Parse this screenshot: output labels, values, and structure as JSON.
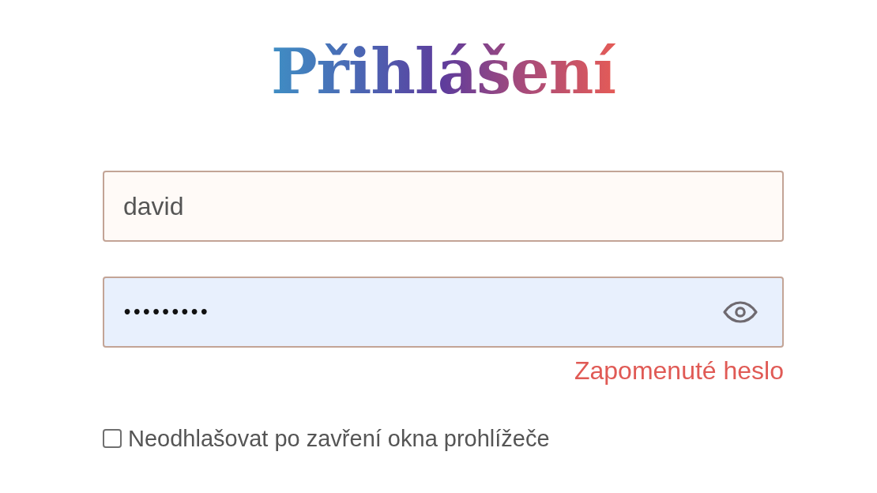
{
  "title": "Přihlášení",
  "fields": [
    {
      "kind": "text",
      "value": "david",
      "autofilled": false
    },
    {
      "kind": "password",
      "value": "•••••••••",
      "autofilled": true
    }
  ],
  "forgot_link": "Zapomenuté heslo",
  "remember": {
    "label": "Neodhlašovat po zavření okna prohlížeče",
    "checked": false
  }
}
